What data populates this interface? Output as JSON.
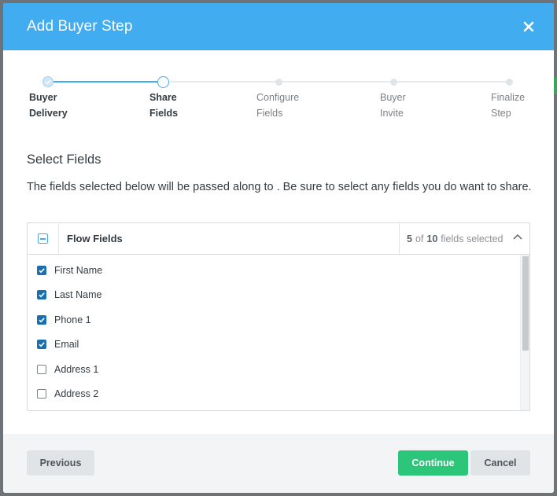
{
  "modal": {
    "title": "Add Buyer Step"
  },
  "stepper": {
    "steps": [
      {
        "line1": "Buyer",
        "line2": "Delivery",
        "state": "done"
      },
      {
        "line1": "Share",
        "line2": "Fields",
        "state": "current"
      },
      {
        "line1": "Configure",
        "line2": "Fields",
        "state": "upcoming"
      },
      {
        "line1": "Buyer",
        "line2": "Invite",
        "state": "upcoming"
      },
      {
        "line1": "Finalize",
        "line2": "Step",
        "state": "upcoming"
      }
    ]
  },
  "section": {
    "title": "Select Fields",
    "description": "The fields selected below will be passed along to . Be sure to select any fields you do want to share."
  },
  "fields_panel": {
    "header_title": "Flow Fields",
    "selected_count": "5",
    "total_count": "10",
    "of_text": "of",
    "selected_suffix": "fields selected",
    "fields": [
      {
        "label": "First Name",
        "checked": true
      },
      {
        "label": "Last Name",
        "checked": true
      },
      {
        "label": "Phone 1",
        "checked": true
      },
      {
        "label": "Email",
        "checked": true
      },
      {
        "label": "Address 1",
        "checked": false
      },
      {
        "label": "Address 2",
        "checked": false
      }
    ]
  },
  "footer": {
    "previous_label": "Previous",
    "continue_label": "Continue",
    "cancel_label": "Cancel"
  },
  "colors": {
    "header_blue": "#41acef",
    "continue_green": "#2bc679",
    "checkbox_blue": "#1a6fb0"
  }
}
